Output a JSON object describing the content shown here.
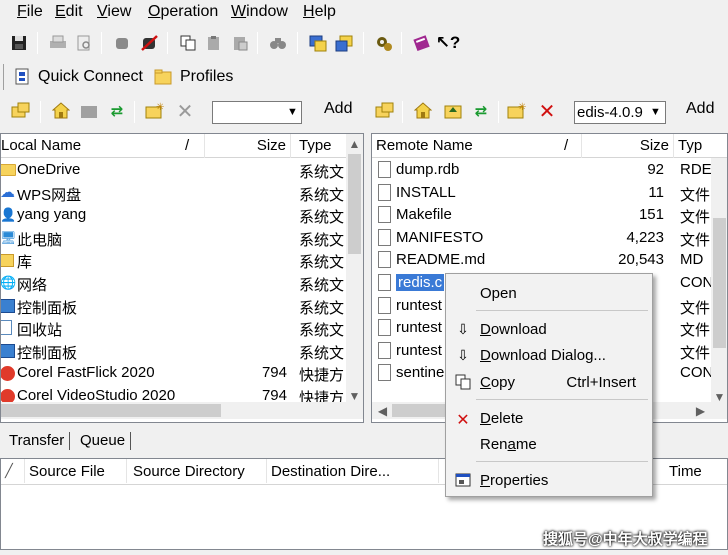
{
  "menu": {
    "file": {
      "u": "F",
      "rest": "ile"
    },
    "edit": {
      "u": "E",
      "rest": "dit"
    },
    "view": {
      "u": "V",
      "rest": "iew"
    },
    "operation": {
      "u": "O",
      "rest": "peration"
    },
    "window": {
      "u": "W",
      "rest": "indow"
    },
    "help": {
      "u": "H",
      "rest": "elp"
    }
  },
  "connect_bar": {
    "quick_connect": "Quick Connect",
    "profiles": "Profiles"
  },
  "local_toolbar": {
    "path_value": "",
    "add_label": "Add"
  },
  "remote_toolbar": {
    "path_value": "edis-4.0.9",
    "add_label": "Add"
  },
  "local": {
    "columns": {
      "name": "Local Name",
      "sort": "/",
      "size": "Size",
      "type": "Type"
    },
    "rows": [
      {
        "name": "OneDrive",
        "size": "",
        "type": "系统文",
        "icon": "folder"
      },
      {
        "name": "WPS网盘",
        "size": "",
        "type": "系统文",
        "icon": "cloud"
      },
      {
        "name": "yang yang",
        "size": "",
        "type": "系统文",
        "icon": "user"
      },
      {
        "name": "此电脑",
        "size": "",
        "type": "系统文",
        "icon": "computer"
      },
      {
        "name": "库",
        "size": "",
        "type": "系统文",
        "icon": "library"
      },
      {
        "name": "网络",
        "size": "",
        "type": "系统文",
        "icon": "network"
      },
      {
        "name": "控制面板",
        "size": "",
        "type": "系统文",
        "icon": "control-panel"
      },
      {
        "name": "回收站",
        "size": "",
        "type": "系统文",
        "icon": "recycle-bin"
      },
      {
        "name": "控制面板",
        "size": "",
        "type": "系统文",
        "icon": "control-panel"
      },
      {
        "name": "Corel FastFlick 2020",
        "size": "794",
        "type": "快捷方",
        "icon": "corel"
      },
      {
        "name": "Corel VideoStudio 2020",
        "size": "794",
        "type": "快捷方",
        "icon": "corel"
      }
    ]
  },
  "remote": {
    "columns": {
      "name": "Remote Name",
      "sort": "/",
      "size": "Size",
      "type": "Typ"
    },
    "rows": [
      {
        "name": "dump.rdb",
        "size": "92",
        "type": "RDE"
      },
      {
        "name": "INSTALL",
        "size": "11",
        "type": "文件"
      },
      {
        "name": "Makefile",
        "size": "151",
        "type": "文件"
      },
      {
        "name": "MANIFESTO",
        "size": "4,223",
        "type": "文件"
      },
      {
        "name": "README.md",
        "size": "20,543",
        "type": "MD"
      },
      {
        "name": "redis.c",
        "size": "",
        "type": "CON"
      },
      {
        "name": "runtest",
        "size": "",
        "type": "文件"
      },
      {
        "name": "runtest",
        "size": "",
        "type": "文件"
      },
      {
        "name": "runtest",
        "size": "",
        "type": "文件"
      },
      {
        "name": "sentine",
        "size": "",
        "type": "CON"
      }
    ]
  },
  "context_menu": {
    "open": "Open",
    "download": {
      "u": "D",
      "rest": "ownload"
    },
    "download_dialog": {
      "u": "D",
      "rest": "ownload Dialog..."
    },
    "copy": {
      "u": "C",
      "rest": "opy"
    },
    "copy_key": "Ctrl+Insert",
    "delete": {
      "u": "D",
      "rest": "elete"
    },
    "rename": {
      "pre": "Ren",
      "u": "a",
      "rest": "me"
    },
    "properties": {
      "u": "P",
      "rest": "roperties"
    }
  },
  "tabs": {
    "transfer": "Transfer",
    "queue": "Queue"
  },
  "transfer_columns": {
    "source_file": "Source File",
    "source_directory": "Source Directory",
    "destination_directory": "Destination Dire...",
    "time": "Time"
  },
  "watermark": "搜狐号@中年大叔学编程"
}
